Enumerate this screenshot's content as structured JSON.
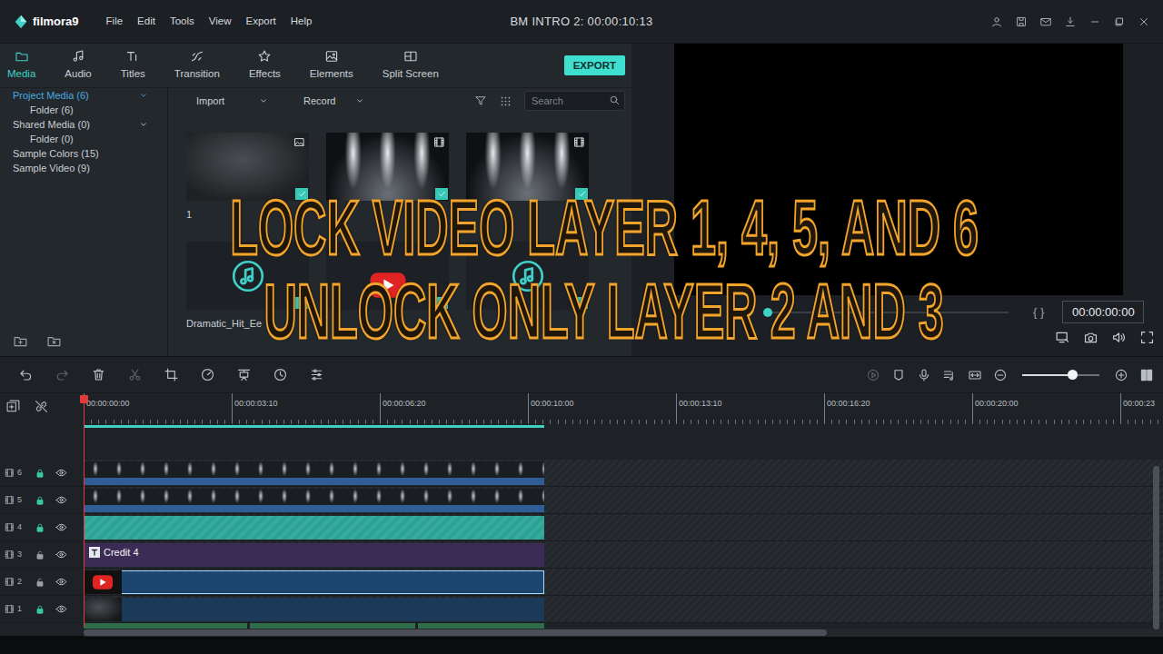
{
  "window": {
    "app": "filmora9",
    "title": "BM INTRO 2:  00:00:10:13"
  },
  "menu": [
    "File",
    "Edit",
    "Tools",
    "View",
    "Export",
    "Help"
  ],
  "tabs": [
    {
      "label": "Media",
      "selected": true
    },
    {
      "label": "Audio",
      "selected": false
    },
    {
      "label": "Titles",
      "selected": false
    },
    {
      "label": "Transition",
      "selected": false
    },
    {
      "label": "Effects",
      "selected": false
    },
    {
      "label": "Elements",
      "selected": false
    },
    {
      "label": "Split Screen",
      "selected": false
    }
  ],
  "export_button": "EXPORT",
  "library": [
    {
      "label": "Project Media (6)",
      "kind": "group",
      "selected": true,
      "expanded": true
    },
    {
      "label": "Folder (6)",
      "kind": "folder",
      "selected": false,
      "expanded": false
    },
    {
      "label": "Shared Media (0)",
      "kind": "group",
      "selected": false,
      "expanded": true
    },
    {
      "label": "Folder (0)",
      "kind": "folder",
      "selected": false,
      "expanded": false
    },
    {
      "label": "Sample Colors (15)",
      "kind": "group",
      "selected": false,
      "expanded": false
    },
    {
      "label": "Sample Video (9)",
      "kind": "group",
      "selected": false,
      "expanded": false
    }
  ],
  "media_bar": {
    "import": "Import",
    "record": "Record",
    "search_placeholder": "Search"
  },
  "media": [
    {
      "label": "1",
      "kind": "image",
      "used": true
    },
    {
      "kind": "lights",
      "used": true
    },
    {
      "kind": "lights",
      "used": true
    },
    {
      "label": "Dramatic_Hit_Ee",
      "kind": "audio",
      "used": true
    },
    {
      "kind": "logo",
      "used": true
    },
    {
      "kind": "audio",
      "used": true
    }
  ],
  "preview": {
    "brackets": "{ }",
    "timecode": "00:00:00:00",
    "level": 0
  },
  "ruler": [
    "00:00:00:00",
    "00:00:03:10",
    "00:00:06:20",
    "00:00:10:00",
    "00:00:13:10",
    "00:00:16:20",
    "00:00:20:00",
    "00:00:23"
  ],
  "zoom": {
    "level": 0.65
  },
  "tracks": [
    {
      "number": "6",
      "kind": "lights",
      "locked": true,
      "visible": true,
      "selected": false
    },
    {
      "number": "5",
      "kind": "lights",
      "locked": true,
      "visible": true,
      "selected": false
    },
    {
      "number": "4",
      "kind": "color",
      "locked": true,
      "visible": true,
      "selected": false
    },
    {
      "number": "3",
      "kind": "title",
      "label": "Credit 4",
      "locked": false,
      "visible": true,
      "selected": false
    },
    {
      "number": "2",
      "kind": "logo",
      "locked": false,
      "visible": true,
      "selected": true
    },
    {
      "number": "1",
      "kind": "texture",
      "locked": true,
      "visible": true,
      "selected": false
    }
  ],
  "caption": [
    "LOCK VIDEO LAYER 1, 4, 5, AND 6",
    "UNLOCK ONLY LAYER 2 AND 3"
  ]
}
